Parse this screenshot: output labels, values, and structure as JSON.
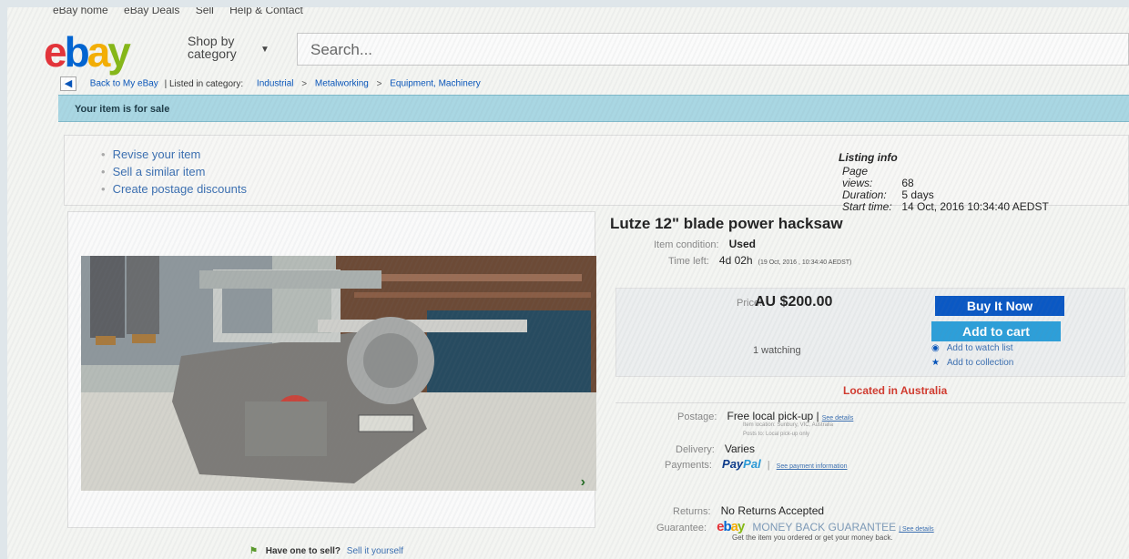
{
  "topnav": [
    "eBay home",
    "eBay Deals",
    "Sell",
    "Help & Contact"
  ],
  "header": {
    "logo": {
      "e": "e",
      "b": "b",
      "a": "a",
      "y": "y"
    },
    "shop_by": "Shop by",
    "category": "category",
    "search_placeholder": "Search..."
  },
  "breadcrumb": {
    "back_label": "Back to My eBay",
    "listed_label": "| Listed in category:",
    "items": [
      "Industrial",
      "Metalworking",
      "Equipment, Machinery"
    ],
    "separator": ">"
  },
  "banner": "Your item is for sale",
  "actions": [
    "Revise your item",
    "Sell a similar item",
    "Create postage discounts"
  ],
  "listing_info": {
    "heading": "Listing info",
    "rows": [
      {
        "label": "Page views:",
        "value": "68"
      },
      {
        "label": "Duration:",
        "value": "5 days"
      },
      {
        "label": "Start time:",
        "value": "14 Oct, 2016 10:34:40 AEDST"
      }
    ]
  },
  "item": {
    "title": "Lutze 12\" blade power hacksaw",
    "condition_label": "Item condition:",
    "condition": "Used",
    "time_left_label": "Time left:",
    "time_left": "4d 02h",
    "time_left_end": "(19 Oct, 2016 , 10:34:40 AEDST)",
    "price_label": "Price:",
    "price": "AU $200.00",
    "buy_now": "Buy It Now",
    "add_to_cart": "Add to cart",
    "watching": "1 watching",
    "add_watch": "Add to watch list",
    "add_collection": "Add to collection",
    "located": "Located in Australia"
  },
  "shipping": {
    "postage_label": "Postage:",
    "postage": "Free local pick-up |",
    "see_details": "See details",
    "item_location": "Item location: Sunbury, VIC, Australia",
    "posts_to": "Posts to: Local pick-up only",
    "delivery_label": "Delivery:",
    "delivery": "Varies",
    "payments_label": "Payments:",
    "paypal_a": "Pay",
    "paypal_b": "Pal",
    "payment_info": "See payment information",
    "returns_label": "Returns:",
    "returns": "No Returns Accepted",
    "guarantee_label": "Guarantee:",
    "guarantee": "MONEY BACK GUARANTEE",
    "guarantee_details": "| See details",
    "guarantee_sub": "Get the item you ordered or get your money back."
  },
  "footer": {
    "have_one": "Have one to sell?",
    "sell_it": "Sell it yourself"
  },
  "colors": {
    "banner": "#a9d7e3",
    "buy_now": "#0a58c4",
    "add_to_cart": "#2d9fd9",
    "located": "#d23a2e"
  }
}
